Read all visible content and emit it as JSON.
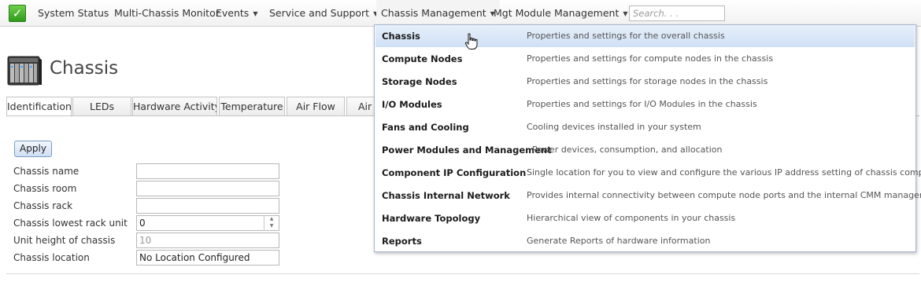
{
  "nav": {
    "items": [
      {
        "label": "System Status",
        "has_caret": false
      },
      {
        "label": "Multi-Chassis Monitor",
        "has_caret": false
      },
      {
        "label": "Events",
        "has_caret": true
      },
      {
        "label": "Service and Support",
        "has_caret": true
      },
      {
        "label": "Chassis Management",
        "has_caret": true
      },
      {
        "label": "Mgt Module Management",
        "has_caret": true
      }
    ],
    "search_placeholder": "Search. . .",
    "status_color": "#3cab22"
  },
  "page": {
    "title": "Chassis"
  },
  "tabs": [
    "Identification",
    "LEDs",
    "Hardware Activity",
    "Temperature",
    "Air Flow",
    "Air F"
  ],
  "form": {
    "apply_label": "Apply",
    "fields": [
      {
        "label": "Chassis name",
        "value": ""
      },
      {
        "label": "Chassis room",
        "value": ""
      },
      {
        "label": "Chassis rack",
        "value": ""
      },
      {
        "label": "Chassis lowest rack unit",
        "value": "0"
      },
      {
        "label": "Unit height of chassis",
        "value": "10"
      },
      {
        "label": "Chassis location",
        "value": "No Location Configured"
      }
    ]
  },
  "menu": {
    "items": [
      {
        "label": "Chassis",
        "desc": "Properties and settings for the overall chassis"
      },
      {
        "label": "Compute Nodes",
        "desc": "Properties and settings for compute nodes in the chassis"
      },
      {
        "label": "Storage Nodes",
        "desc": "Properties and settings for storage nodes in the chassis"
      },
      {
        "label": "I/O Modules",
        "desc": "Properties and settings for I/O Modules in the chassis"
      },
      {
        "label": "Fans and Cooling",
        "desc": "Cooling devices installed in your system"
      },
      {
        "label": "Power Modules and Management",
        "desc": "Power devices, consumption, and allocation"
      },
      {
        "label": "Component IP Configuration",
        "desc": "Single location for you to view and configure the various IP address setting of chassis components"
      },
      {
        "label": "Chassis Internal Network",
        "desc": "Provides internal connectivity between compute node ports and the internal CMM management port"
      },
      {
        "label": "Hardware Topology",
        "desc": "Hierarchical view of components in your chassis"
      },
      {
        "label": "Reports",
        "desc": "Generate Reports of hardware information"
      }
    ],
    "highlight_color": "#d7e6f7"
  }
}
